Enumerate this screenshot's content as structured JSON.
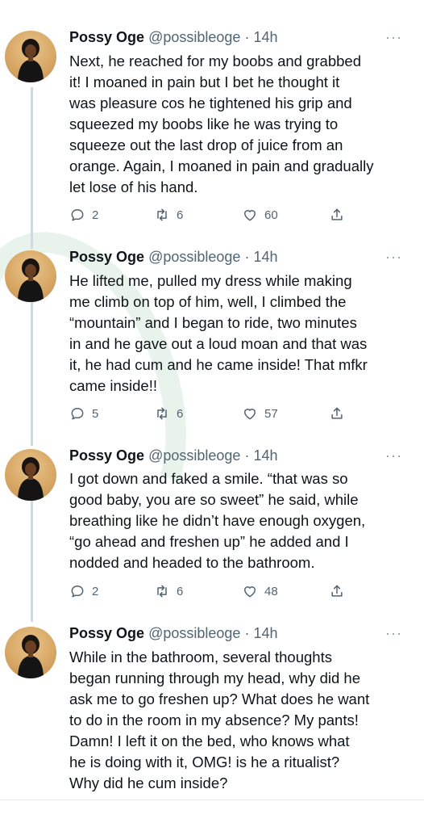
{
  "tweets": [
    {
      "author_name": "Possy Oge",
      "author_handle": "@possibleoge",
      "separator": "·",
      "time": "14h",
      "more_icon": "more-horizontal-icon",
      "text_lines": [
        "Next, he reached for my boobs and grabbed",
        "it! I moaned in pain but I bet he thought it",
        "was pleasure cos he tightened his grip and",
        "squeezed my boobs like he was trying to",
        "squeeze out the last drop of juice from an",
        "orange. Again, I moaned in pain and gradually",
        "let lose of his hand."
      ],
      "replies": "2",
      "retweets": "6",
      "likes": "60"
    },
    {
      "author_name": "Possy Oge",
      "author_handle": "@possibleoge",
      "separator": "·",
      "time": "14h",
      "more_icon": "more-horizontal-icon",
      "text_lines": [
        "He lifted me, pulled my dress while making",
        "me climb on top of him, well, I climbed the",
        "“mountain” and I began to ride, two minutes",
        "in and he gave out a loud moan and that was",
        "it, he had cum and he came inside! That mfkr",
        "came inside!!"
      ],
      "replies": "5",
      "retweets": "6",
      "likes": "57"
    },
    {
      "author_name": "Possy Oge",
      "author_handle": "@possibleoge",
      "separator": "·",
      "time": "14h",
      "more_icon": "more-horizontal-icon",
      "text_lines": [
        "I got down and faked a smile. “that was so",
        "good baby, you are so sweet” he said, while",
        "breathing like he didn’t have enough oxygen,",
        "“go ahead and freshen up” he added and I",
        "nodded and headed to the bathroom."
      ],
      "replies": "2",
      "retweets": "6",
      "likes": "48"
    },
    {
      "author_name": "Possy Oge",
      "author_handle": "@possibleoge",
      "separator": "·",
      "time": "14h",
      "more_icon": "more-horizontal-icon",
      "text_lines": [
        "While in the bathroom, several thoughts",
        "began running through my head, why did he",
        "ask me to go freshen up? What does he want",
        "to do in the room in my absence? My pants!",
        "Damn! I left it on the bed, who knows what",
        "he is doing with it, OMG! is he a ritualist?",
        "Why did he cum inside?"
      ]
    }
  ],
  "colors": {
    "text": "#0f1419",
    "secondary": "#536471",
    "thread_line": "#cfd9de",
    "watermark": "#2e9e4a"
  }
}
